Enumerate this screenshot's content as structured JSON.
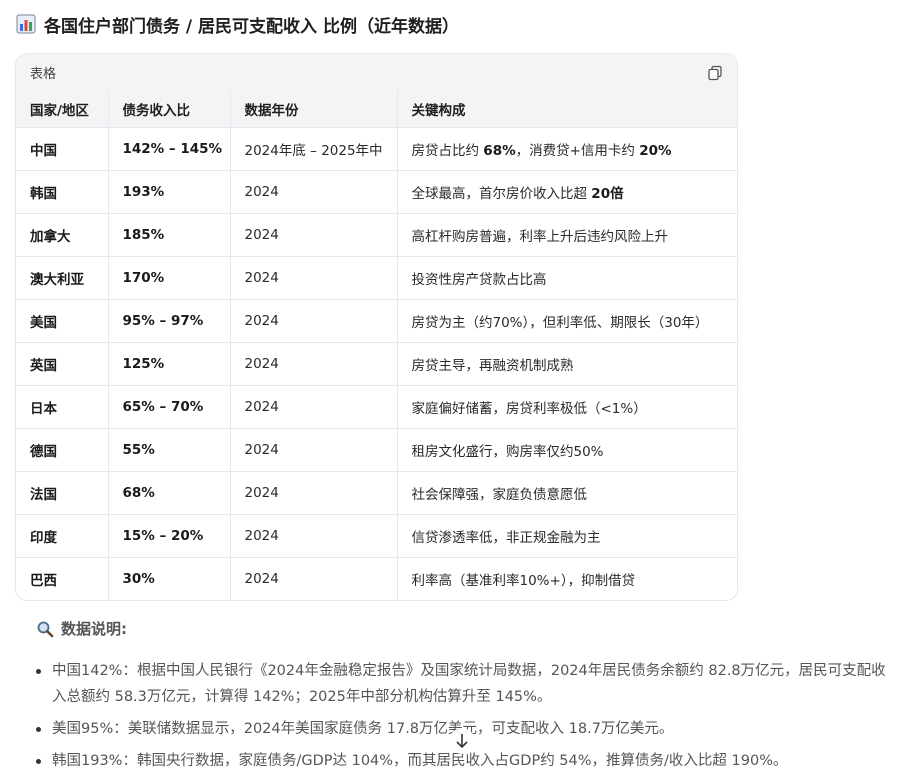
{
  "heading": {
    "title": "各国住户部门债务 / 居民可支配收入 比例（近年数据）"
  },
  "table_card": {
    "header_label": "表格",
    "columns": [
      "国家/地区",
      "债务收入比",
      "数据年份",
      "关键构成"
    ],
    "rows": [
      {
        "country": "中国",
        "ratio": "142% – 145%",
        "year": "2024年底 – 2025年中",
        "key": [
          [
            "房贷占比约 ",
            ""
          ],
          [
            "68%",
            "b"
          ],
          [
            "，消费贷+信用卡约 ",
            ""
          ],
          [
            "20%",
            "b"
          ]
        ]
      },
      {
        "country": "韩国",
        "ratio": "193%",
        "year": "2024",
        "key": [
          [
            "全球最高，首尔房价收入比超 ",
            ""
          ],
          [
            "20倍",
            "b"
          ]
        ]
      },
      {
        "country": "加拿大",
        "ratio": "185%",
        "year": "2024",
        "key": [
          [
            "高杠杆购房普遍，利率上升后违约风险上升",
            ""
          ]
        ]
      },
      {
        "country": "澳大利亚",
        "ratio": "170%",
        "year": "2024",
        "key": [
          [
            "投资性房产贷款占比高",
            ""
          ]
        ]
      },
      {
        "country": "美国",
        "ratio": "95% – 97%",
        "year": "2024",
        "key": [
          [
            "房贷为主（约70%），但利率低、期限长（30年）",
            ""
          ]
        ]
      },
      {
        "country": "英国",
        "ratio": "125%",
        "year": "2024",
        "key": [
          [
            "房贷主导，再融资机制成熟",
            ""
          ]
        ]
      },
      {
        "country": "日本",
        "ratio": "65% – 70%",
        "year": "2024",
        "key": [
          [
            "家庭偏好储蓄，房贷利率极低（<1%）",
            ""
          ]
        ]
      },
      {
        "country": "德国",
        "ratio": "55%",
        "year": "2024",
        "key": [
          [
            "租房文化盛行，购房率仅约50%",
            ""
          ]
        ]
      },
      {
        "country": "法国",
        "ratio": "68%",
        "year": "2024",
        "key": [
          [
            "社会保障强，家庭负债意愿低",
            ""
          ]
        ]
      },
      {
        "country": "印度",
        "ratio": "15% – 20%",
        "year": "2024",
        "key": [
          [
            "信贷渗透率低，非正规金融为主",
            ""
          ]
        ]
      },
      {
        "country": "巴西",
        "ratio": "30%",
        "year": "2024",
        "key": [
          [
            "利率高（基准利率10%+），抑制借贷",
            ""
          ]
        ]
      }
    ]
  },
  "notes": {
    "title": "数据说明:",
    "items": [
      "中国142%：根据中国人民银行《2024年金融稳定报告》及国家统计局数据，2024年居民债务余额约 82.8万亿元，居民可支配收入总额约 58.3万亿元，计算得 142%；2025年中部分机构估算升至 145%。",
      "美国95%：美联储数据显示，2024年美国家庭债务 17.8万亿美元，可支配收入 18.7万亿美元。",
      "韩国193%：韩国央行数据，家庭债务/GDP达 104%，而其居民收入占GDP约 54%，推算债务/收入比超 190%。"
    ]
  },
  "icons": {
    "heading": "bar-chart-icon",
    "copy": "copy-icon",
    "notes": "magnifier-icon",
    "scroll": "arrow-down-icon"
  }
}
